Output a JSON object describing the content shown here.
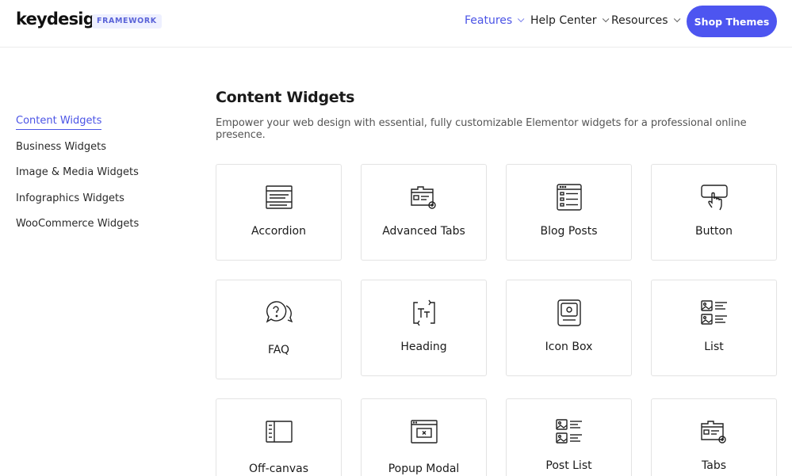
{
  "header": {
    "logo": "keydesign",
    "badge": "FRAMEWORK",
    "nav": [
      {
        "label": "Features"
      },
      {
        "label": "Help Center"
      },
      {
        "label": "Resources"
      }
    ],
    "cta_label": "Shop Themes",
    "accent_color": "#4d55f0"
  },
  "sidebar": {
    "items": [
      {
        "label": "Content Widgets",
        "active": true
      },
      {
        "label": "Business Widgets"
      },
      {
        "label": "Image & Media Widgets"
      },
      {
        "label": "Infographics Widgets"
      },
      {
        "label": "WooCommerce Widgets"
      }
    ]
  },
  "main": {
    "title": "Content Widgets",
    "subtitle": "Empower your web design with essential, fully customizable Elementor widgets for a professional online presence.",
    "widgets": [
      {
        "label": "Accordion",
        "icon": "accordion-icon"
      },
      {
        "label": "Advanced Tabs",
        "icon": "advanced-tabs-icon"
      },
      {
        "label": "Blog Posts",
        "icon": "blog-posts-icon"
      },
      {
        "label": "Button",
        "icon": "button-click-icon"
      },
      {
        "label": "FAQ",
        "icon": "faq-icon"
      },
      {
        "label": "Heading",
        "icon": "heading-icon"
      },
      {
        "label": "Icon Box",
        "icon": "icon-box-icon"
      },
      {
        "label": "List",
        "icon": "list-icon"
      },
      {
        "label": "Off-canvas",
        "icon": "off-canvas-icon"
      },
      {
        "label": "Popup Modal",
        "icon": "popup-modal-icon"
      },
      {
        "label": "Post List",
        "icon": "post-list-icon"
      },
      {
        "label": "Tabs",
        "icon": "tabs-icon"
      }
    ]
  }
}
